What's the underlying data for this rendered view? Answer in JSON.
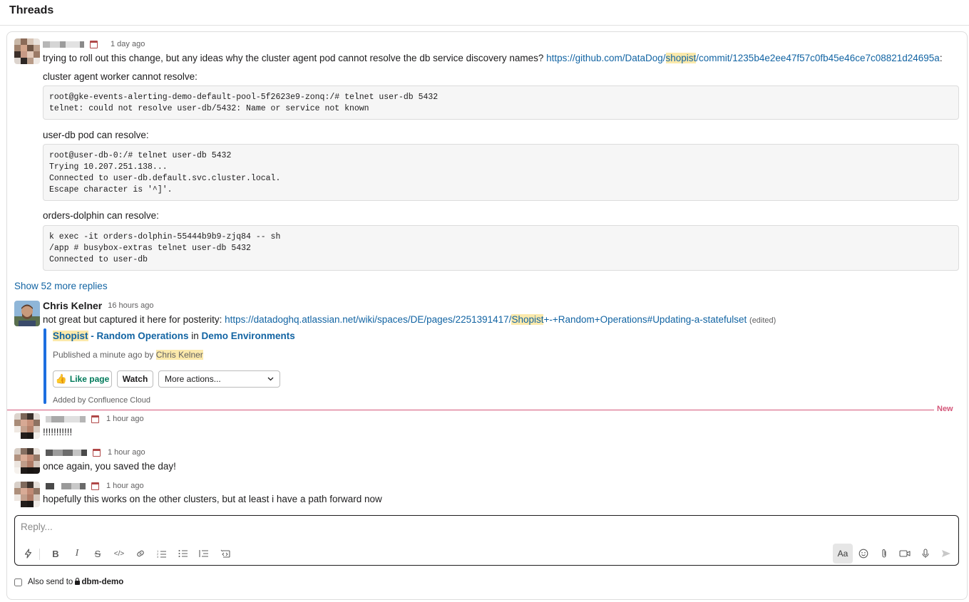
{
  "header": {
    "title": "Threads"
  },
  "messages": [
    {
      "timestamp": "1 day ago",
      "text_before_link": "trying to roll out this change, but any ideas why the cluster agent pod cannot resolve the db service discovery names? ",
      "link_part1": "https://github.com/DataDog/",
      "link_highlight": "shopist",
      "link_part2": "/commit/1235b4e2ee47f57c0fb45e46ce7c08821d24695a",
      "text_after_link": ":",
      "sections": [
        {
          "label": "cluster agent worker cannot resolve:",
          "code": "root@gke-events-alerting-demo-default-pool-5f2623e9-zonq:/# telnet user-db 5432\ntelnet: could not resolve user-db/5432: Name or service not known"
        },
        {
          "label": "user-db pod can resolve:",
          "code": "root@user-db-0:/# telnet user-db 5432\nTrying 10.207.251.138...\nConnected to user-db.default.svc.cluster.local.\nEscape character is '^]'."
        },
        {
          "label": "orders-dolphin can resolve:",
          "code": "k exec -it orders-dolphin-55444b9b9-zjq84 -- sh\n/app # busybox-extras telnet user-db 5432\nConnected to user-db"
        }
      ]
    },
    {
      "author": "Chris Kelner",
      "timestamp": "16 hours ago",
      "text_before_link": "not great but captured it here for posterity: ",
      "link_part1": "https://datadoghq.atlassian.net/wiki/spaces/DE/pages/2251391417/",
      "link_highlight": "Shopist",
      "link_part2": "+-+Random+Operations#Updating-a-statefulset",
      "edited": "(edited)",
      "attachment": {
        "title_highlight": "Shopist",
        "title_rest": " - Random Operations",
        "in_word": " in ",
        "space": "Demo Environments",
        "published_prefix": "Published a minute ago by ",
        "published_by": "Chris Kelner",
        "like_icon": "👍",
        "like_label": "Like page",
        "watch_label": "Watch",
        "more_actions_label": "More actions...",
        "footer": "Added by Confluence Cloud"
      }
    },
    {
      "timestamp": "1 hour ago",
      "text": "!!!!!!!!!!!"
    },
    {
      "timestamp": "1 hour ago",
      "text": "once again, you saved the day!"
    },
    {
      "timestamp": "1 hour ago",
      "text": "hopefully this works on the other clusters, but at least i have a path forward now"
    }
  ],
  "show_more": "Show 52 more replies",
  "new_divider": "New",
  "composer": {
    "placeholder": "Reply...",
    "toolbar": {
      "shortcuts_icon": "lightning-icon",
      "bold": "B",
      "italic": "I",
      "strike": "S",
      "code": "</>",
      "formatting": "Aa"
    }
  },
  "also_send": {
    "prefix": "Also send to ",
    "channel": "dbm-demo"
  },
  "colors": {
    "link": "#1264a3",
    "highlight": "#fbe9ab",
    "new_divider": "#d4577a",
    "attachment_bar": "#1d6fe0"
  }
}
